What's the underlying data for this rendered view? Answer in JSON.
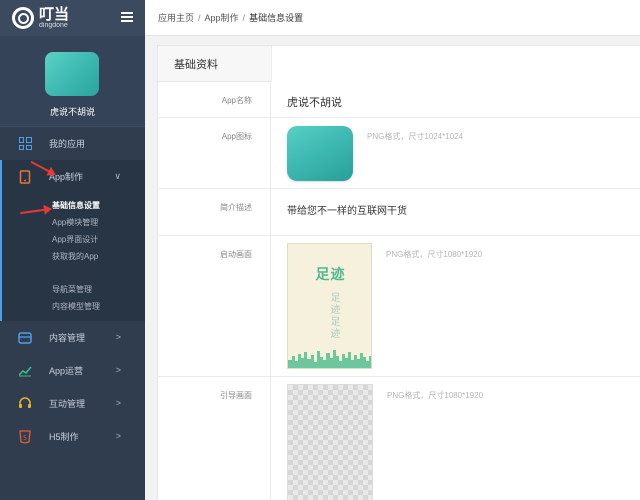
{
  "logo": {
    "cn": "叮当",
    "en": "dingdone"
  },
  "profile": {
    "app_name": "虎说不胡说"
  },
  "menu": {
    "my_apps": "我的应用",
    "app_make": "App制作",
    "content": "内容管理",
    "operations": "App运营",
    "interaction": "互动管理",
    "h5": "H5制作"
  },
  "submenu": {
    "basic_info": "基础信息设置",
    "modules": "App模块管理",
    "ui_design": "App界面设计",
    "get_app": "获取我的App",
    "navigation": "导航菜管理",
    "content_model": "内容模型管理"
  },
  "breadcrumb": {
    "home": "应用主页",
    "sep": "/",
    "app": "App制作",
    "current": "基础信息设置"
  },
  "panel": {
    "title": "基础资料"
  },
  "form": {
    "name_label": "App名称",
    "name_value": "虎说不胡说",
    "icon_label": "App图标",
    "icon_hint": "PNG格式，尺寸1024*1024",
    "desc_label": "简介描述",
    "desc_value": "带给您不一样的互联网干货",
    "splash_label": "启动画面",
    "splash_hint": "PNG格式，尺寸1080*1920",
    "guide_label": "引导画面",
    "guide_hint": "PNG格式，尺寸1080*1920"
  },
  "splash": {
    "title": "足迹",
    "vertical": "足迹足迹"
  },
  "colors": {
    "sidebar": "#2f3d4f",
    "accent": "#4e9eea",
    "teal": "#3fbab2",
    "arrow": "#e53935"
  }
}
